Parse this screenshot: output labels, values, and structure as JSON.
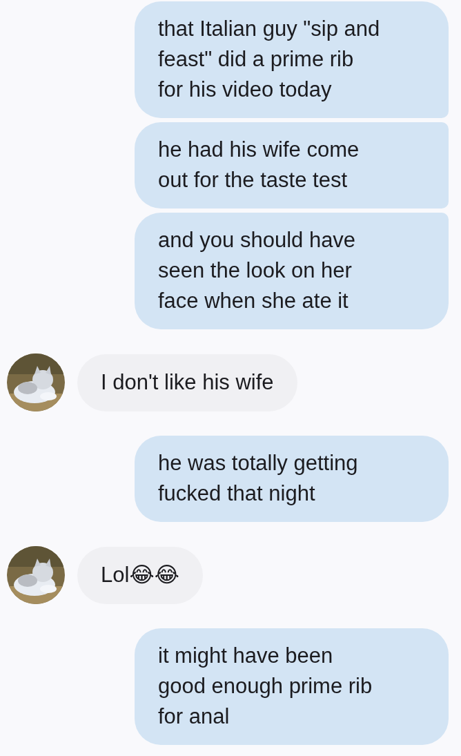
{
  "messages": [
    {
      "kind": "outgoing",
      "text": "that Italian guy \"sip and\nfeast\" did a prime rib\nfor his video today"
    },
    {
      "kind": "outgoing",
      "text": "he had his wife come\nout for the taste test"
    },
    {
      "kind": "outgoing",
      "text": "and you should have\nseen the look on her\nface when she ate it"
    },
    {
      "kind": "incoming",
      "text": "I don't like his wife"
    },
    {
      "kind": "outgoing",
      "text": "he was totally getting\nfucked that night"
    },
    {
      "kind": "incoming",
      "text": "Lol😂😂"
    },
    {
      "kind": "outgoing",
      "text": "it might have been\ngood enough prime rib\nfor anal"
    }
  ]
}
